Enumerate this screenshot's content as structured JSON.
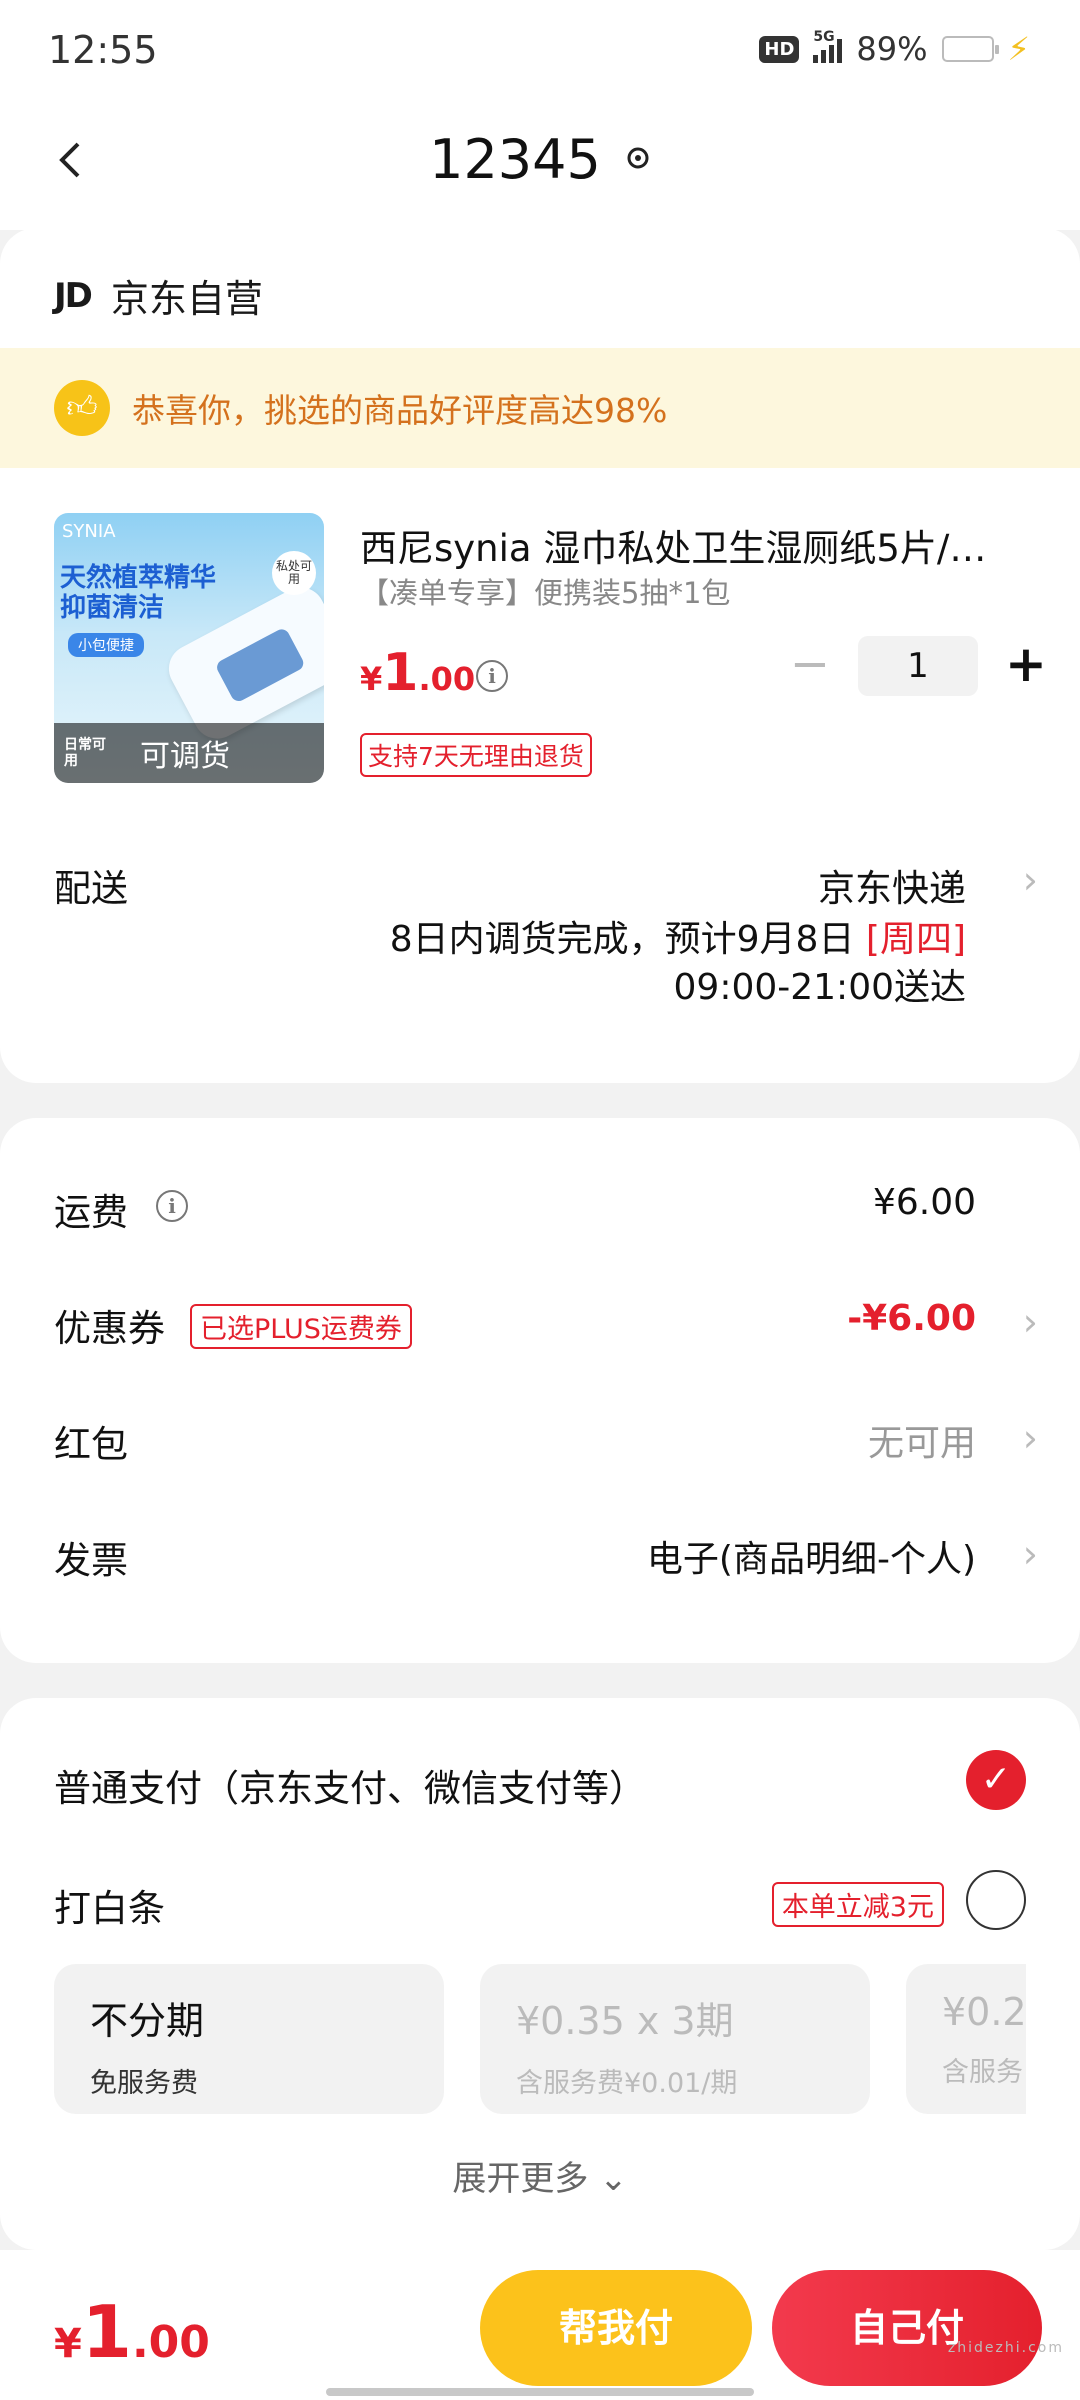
{
  "status_bar": {
    "time": "12:55",
    "hd": "HD",
    "network": "5G",
    "battery_percent": "89%",
    "battery_level": 0.89,
    "charging_icon": "charging-bolt-icon"
  },
  "header": {
    "title": "12345",
    "back_icon": "chevron-left-icon",
    "location_icon": "location-pin-icon"
  },
  "order": {
    "shop_logo": "JD",
    "shop_name": "京东自营",
    "praise": "恭喜你，挑选的商品好评度高达98%",
    "product": {
      "title": "西尼synia 湿巾私处卫生湿厕纸5片/…",
      "spec": "【凑单专享】便携装5抽*1包",
      "price_currency": "¥",
      "price_int": "1",
      "price_dec": ".00",
      "quantity": "1",
      "minus": "−",
      "plus": "+",
      "return_badge": "支持7天无理由退货",
      "image_brand": "SYNIA",
      "image_title_line1": "天然植萃精华",
      "image_title_line2": "抑菌清洁",
      "image_pill": "小包便捷",
      "image_seal": "私处可用",
      "image_mini": "日常可用",
      "image_tag": "可调货"
    },
    "delivery": {
      "label": "配送",
      "method": "京东快递",
      "note_prefix": "8日内调货完成，预计9月8日 ",
      "note_weekday": "[周四]",
      "time_window": "09:00-21:00送达"
    }
  },
  "fees": {
    "shipping_label": "运费",
    "shipping_value": "¥6.00",
    "coupon_label": "优惠券",
    "coupon_tag": "已选PLUS运费券",
    "coupon_value": "-¥6.00",
    "redpacket_label": "红包",
    "redpacket_value": "无可用",
    "invoice_label": "发票",
    "invoice_value": "电子(商品明细-个人)"
  },
  "payment": {
    "normal_label": "普通支付（京东支付、微信支付等）",
    "baitiao_label": "打白条",
    "baitiao_discount": "本单立减3元",
    "installments": [
      {
        "main": "不分期",
        "sub": "免服务费"
      },
      {
        "main": "¥0.35 x 3期",
        "sub": "含服务费¥0.01/期"
      },
      {
        "main": "¥0.2",
        "sub": "含服务"
      }
    ],
    "expand_more": "展开更多 ⌄"
  },
  "bottom": {
    "total_currency": "¥",
    "total_int": "1",
    "total_dec": ".00",
    "help_pay": "帮我付",
    "self_pay": "自己付",
    "watermark": "zhidezhi.com"
  },
  "colors": {
    "accent_red": "#e4202d",
    "help_yellow": "#fcc21b",
    "praise_orange": "#d4711d",
    "praise_bg": "#fdf7dd"
  }
}
